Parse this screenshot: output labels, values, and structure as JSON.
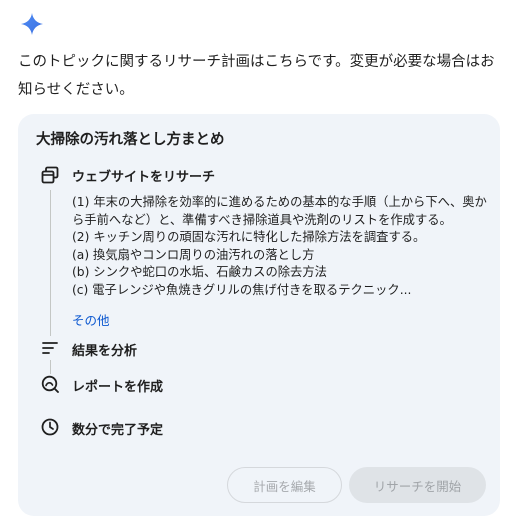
{
  "intro_text": "このトピックに関するリサーチ計画はこちらです。変更が必要な場合はお知らせください。",
  "plan": {
    "title": "大掃除の汚れ落とし方まとめ",
    "steps": [
      {
        "label": "ウェブサイトをリサーチ",
        "icon": "website-search-icon"
      },
      {
        "label": "結果を分析",
        "icon": "analyze-lines-icon"
      },
      {
        "label": "レポートを作成",
        "icon": "report-icon"
      },
      {
        "label": "数分で完了予定",
        "icon": "clock-icon"
      }
    ],
    "details": [
      "(1) 年末の大掃除を効率的に進めるための基本的な手順（上から下へ、奥から手前へなど）と、準備すべき掃除道具や洗剤のリストを作成する。",
      "(2) キッチン周りの頑固な汚れに特化した掃除方法を調査する。",
      "(a) 換気扇やコンロ周りの油汚れの落とし方",
      "(b) シンクや蛇口の水垢、石鹸カスの除去方法",
      "(c) 電子レンジや魚焼きグリルの焦げ付きを取るテクニック..."
    ],
    "more_link": "その他"
  },
  "buttons": {
    "edit": "計画を編集",
    "start": "リサーチを開始"
  },
  "colors": {
    "card_bg": "#f0f4f9",
    "link": "#0b57d0",
    "sparkle_blue": "#4285f4"
  }
}
